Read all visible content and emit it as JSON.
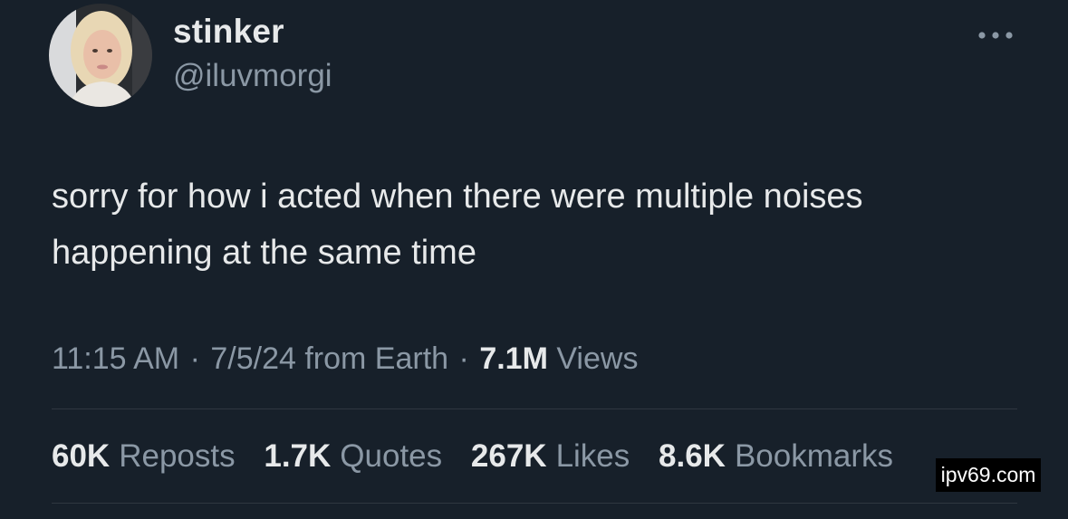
{
  "user": {
    "display_name": "stinker",
    "handle": "@iluvmorgi",
    "avatar_icon": "profile-photo"
  },
  "more_icon": "more-horizontal-icon",
  "tweet": {
    "text_line1": "sorry for how i acted when there were multiple noises",
    "text_line2": "happening at the same time"
  },
  "meta": {
    "time": "11:15 AM",
    "date": "7/5/24",
    "source": "from Earth",
    "separator": "·",
    "views_count": "7.1M",
    "views_label": "Views"
  },
  "stats": [
    {
      "count": "60K",
      "label": "Reposts"
    },
    {
      "count": "1.7K",
      "label": "Quotes"
    },
    {
      "count": "267K",
      "label": "Likes"
    },
    {
      "count": "8.6K",
      "label": "Bookmarks"
    }
  ],
  "watermark": "ipv69.com",
  "colors": {
    "background": "#17202a",
    "primary_text": "#e7e9ea",
    "secondary_text": "#8b98a5",
    "divider": "#2f3740"
  }
}
